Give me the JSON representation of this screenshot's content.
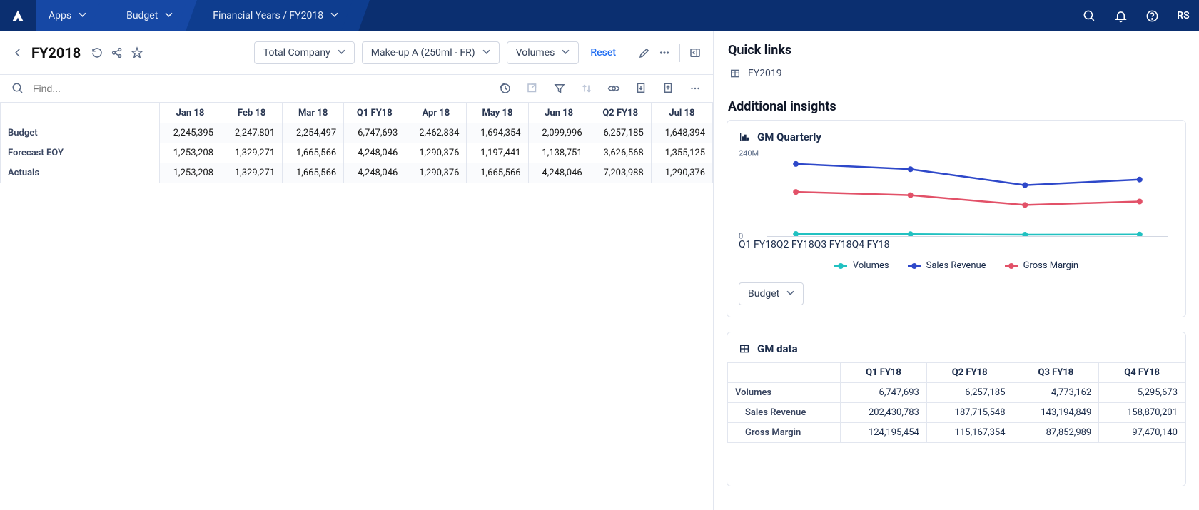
{
  "topnav": {
    "apps_label": "Apps",
    "budget_label": "Budget",
    "breadcrumb": "Financial Years / FY2018",
    "user_initials": "RS"
  },
  "page": {
    "title": "FY2018",
    "filter1": "Total Company",
    "filter2": "Make-up A (250ml - FR)",
    "filter3": "Volumes",
    "reset": "Reset",
    "find_placeholder": "Find..."
  },
  "main_grid": {
    "columns": [
      "Jan 18",
      "Feb 18",
      "Mar 18",
      "Q1 FY18",
      "Apr 18",
      "May 18",
      "Jun 18",
      "Q2 FY18",
      "Jul 18"
    ],
    "rows": [
      {
        "label": "Budget",
        "values": [
          "2,245,395",
          "2,247,801",
          "2,254,497",
          "6,747,693",
          "2,462,834",
          "1,694,354",
          "2,099,996",
          "6,257,185",
          "1,648,394"
        ]
      },
      {
        "label": "Forecast EOY",
        "values": [
          "1,253,208",
          "1,329,271",
          "1,665,566",
          "4,248,046",
          "1,290,376",
          "1,197,441",
          "1,138,751",
          "3,626,568",
          "1,355,125"
        ]
      },
      {
        "label": "Actuals",
        "values": [
          "1,253,208",
          "1,329,271",
          "1,665,566",
          "4,248,046",
          "1,290,376",
          "1,665,566",
          "4,248,046",
          "7,203,988",
          "1,290,376"
        ]
      }
    ]
  },
  "right": {
    "quick_links_title": "Quick links",
    "quick_link_1": "FY2019",
    "insights_title": "Additional insights",
    "chart_title": "GM Quarterly",
    "chart_filter": "Budget",
    "gm_data_title": "GM data",
    "legend": {
      "vol": "Volumes",
      "rev": "Sales Revenue",
      "gm": "Gross Margin"
    },
    "ylabel_top": "240M",
    "ylabel_bottom": "0",
    "xcats": [
      "Q1 FY18",
      "Q2 FY18",
      "Q3 FY18",
      "Q4 FY18"
    ]
  },
  "gm_table": {
    "columns": [
      "Q1 FY18",
      "Q2 FY18",
      "Q3 FY18",
      "Q4 FY18"
    ],
    "rows": [
      {
        "label": "Volumes",
        "indent": 0,
        "values": [
          "6,747,693",
          "6,257,185",
          "4,773,162",
          "5,295,673"
        ]
      },
      {
        "label": "Sales Revenue",
        "indent": 1,
        "values": [
          "202,430,783",
          "187,715,548",
          "143,194,849",
          "158,870,201"
        ]
      },
      {
        "label": "Gross Margin",
        "indent": 1,
        "values": [
          "124,195,454",
          "115,167,354",
          "87,852,989",
          "97,470,140"
        ]
      }
    ]
  },
  "chart_data": {
    "type": "line",
    "title": "GM Quarterly",
    "xlabel": "",
    "ylabel": "",
    "ylim": [
      0,
      240000000
    ],
    "categories": [
      "Q1 FY18",
      "Q2 FY18",
      "Q3 FY18",
      "Q4 FY18"
    ],
    "series": [
      {
        "name": "Volumes",
        "color": "#21c1c1",
        "values": [
          6747693,
          6257185,
          4773162,
          5295673
        ]
      },
      {
        "name": "Sales Revenue",
        "color": "#2e48c9",
        "values": [
          202430783,
          187715548,
          143194849,
          158870201
        ]
      },
      {
        "name": "Gross Margin",
        "color": "#e25168",
        "values": [
          124195454,
          115167354,
          87852989,
          97470140
        ]
      }
    ],
    "legend_position": "bottom"
  }
}
